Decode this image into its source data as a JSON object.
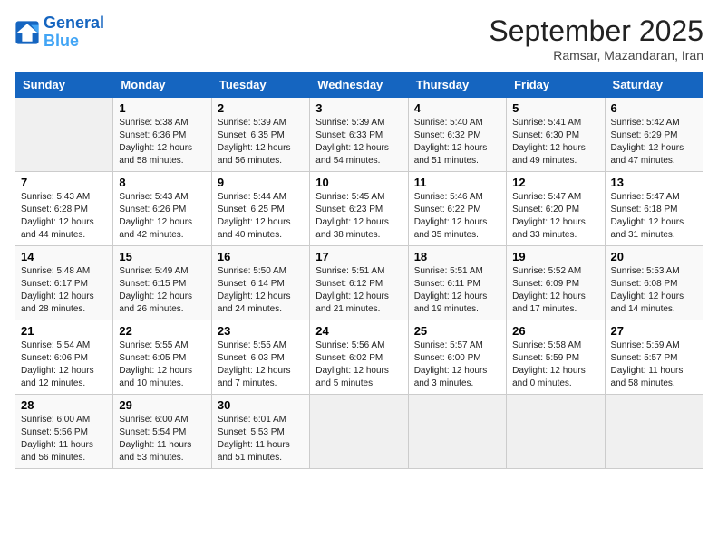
{
  "header": {
    "logo_line1": "General",
    "logo_line2": "Blue",
    "month": "September 2025",
    "location": "Ramsar, Mazandaran, Iran"
  },
  "days_of_week": [
    "Sunday",
    "Monday",
    "Tuesday",
    "Wednesday",
    "Thursday",
    "Friday",
    "Saturday"
  ],
  "weeks": [
    [
      {
        "day": "",
        "info": ""
      },
      {
        "day": "1",
        "info": "Sunrise: 5:38 AM\nSunset: 6:36 PM\nDaylight: 12 hours\nand 58 minutes."
      },
      {
        "day": "2",
        "info": "Sunrise: 5:39 AM\nSunset: 6:35 PM\nDaylight: 12 hours\nand 56 minutes."
      },
      {
        "day": "3",
        "info": "Sunrise: 5:39 AM\nSunset: 6:33 PM\nDaylight: 12 hours\nand 54 minutes."
      },
      {
        "day": "4",
        "info": "Sunrise: 5:40 AM\nSunset: 6:32 PM\nDaylight: 12 hours\nand 51 minutes."
      },
      {
        "day": "5",
        "info": "Sunrise: 5:41 AM\nSunset: 6:30 PM\nDaylight: 12 hours\nand 49 minutes."
      },
      {
        "day": "6",
        "info": "Sunrise: 5:42 AM\nSunset: 6:29 PM\nDaylight: 12 hours\nand 47 minutes."
      }
    ],
    [
      {
        "day": "7",
        "info": "Sunrise: 5:43 AM\nSunset: 6:28 PM\nDaylight: 12 hours\nand 44 minutes."
      },
      {
        "day": "8",
        "info": "Sunrise: 5:43 AM\nSunset: 6:26 PM\nDaylight: 12 hours\nand 42 minutes."
      },
      {
        "day": "9",
        "info": "Sunrise: 5:44 AM\nSunset: 6:25 PM\nDaylight: 12 hours\nand 40 minutes."
      },
      {
        "day": "10",
        "info": "Sunrise: 5:45 AM\nSunset: 6:23 PM\nDaylight: 12 hours\nand 38 minutes."
      },
      {
        "day": "11",
        "info": "Sunrise: 5:46 AM\nSunset: 6:22 PM\nDaylight: 12 hours\nand 35 minutes."
      },
      {
        "day": "12",
        "info": "Sunrise: 5:47 AM\nSunset: 6:20 PM\nDaylight: 12 hours\nand 33 minutes."
      },
      {
        "day": "13",
        "info": "Sunrise: 5:47 AM\nSunset: 6:18 PM\nDaylight: 12 hours\nand 31 minutes."
      }
    ],
    [
      {
        "day": "14",
        "info": "Sunrise: 5:48 AM\nSunset: 6:17 PM\nDaylight: 12 hours\nand 28 minutes."
      },
      {
        "day": "15",
        "info": "Sunrise: 5:49 AM\nSunset: 6:15 PM\nDaylight: 12 hours\nand 26 minutes."
      },
      {
        "day": "16",
        "info": "Sunrise: 5:50 AM\nSunset: 6:14 PM\nDaylight: 12 hours\nand 24 minutes."
      },
      {
        "day": "17",
        "info": "Sunrise: 5:51 AM\nSunset: 6:12 PM\nDaylight: 12 hours\nand 21 minutes."
      },
      {
        "day": "18",
        "info": "Sunrise: 5:51 AM\nSunset: 6:11 PM\nDaylight: 12 hours\nand 19 minutes."
      },
      {
        "day": "19",
        "info": "Sunrise: 5:52 AM\nSunset: 6:09 PM\nDaylight: 12 hours\nand 17 minutes."
      },
      {
        "day": "20",
        "info": "Sunrise: 5:53 AM\nSunset: 6:08 PM\nDaylight: 12 hours\nand 14 minutes."
      }
    ],
    [
      {
        "day": "21",
        "info": "Sunrise: 5:54 AM\nSunset: 6:06 PM\nDaylight: 12 hours\nand 12 minutes."
      },
      {
        "day": "22",
        "info": "Sunrise: 5:55 AM\nSunset: 6:05 PM\nDaylight: 12 hours\nand 10 minutes."
      },
      {
        "day": "23",
        "info": "Sunrise: 5:55 AM\nSunset: 6:03 PM\nDaylight: 12 hours\nand 7 minutes."
      },
      {
        "day": "24",
        "info": "Sunrise: 5:56 AM\nSunset: 6:02 PM\nDaylight: 12 hours\nand 5 minutes."
      },
      {
        "day": "25",
        "info": "Sunrise: 5:57 AM\nSunset: 6:00 PM\nDaylight: 12 hours\nand 3 minutes."
      },
      {
        "day": "26",
        "info": "Sunrise: 5:58 AM\nSunset: 5:59 PM\nDaylight: 12 hours\nand 0 minutes."
      },
      {
        "day": "27",
        "info": "Sunrise: 5:59 AM\nSunset: 5:57 PM\nDaylight: 11 hours\nand 58 minutes."
      }
    ],
    [
      {
        "day": "28",
        "info": "Sunrise: 6:00 AM\nSunset: 5:56 PM\nDaylight: 11 hours\nand 56 minutes."
      },
      {
        "day": "29",
        "info": "Sunrise: 6:00 AM\nSunset: 5:54 PM\nDaylight: 11 hours\nand 53 minutes."
      },
      {
        "day": "30",
        "info": "Sunrise: 6:01 AM\nSunset: 5:53 PM\nDaylight: 11 hours\nand 51 minutes."
      },
      {
        "day": "",
        "info": ""
      },
      {
        "day": "",
        "info": ""
      },
      {
        "day": "",
        "info": ""
      },
      {
        "day": "",
        "info": ""
      }
    ]
  ]
}
